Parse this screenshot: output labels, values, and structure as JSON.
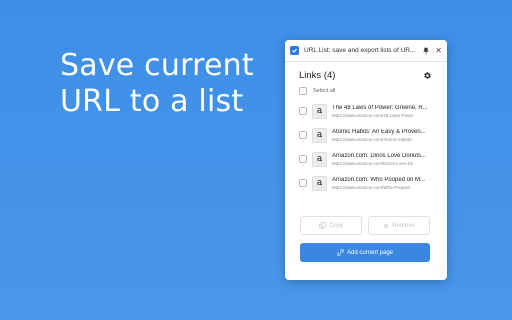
{
  "headline": {
    "line1": "Save current",
    "line2": "URL to a list"
  },
  "popup": {
    "window_title": "URL List: save and export lists of UR...",
    "close_glyph": "✕",
    "panel_title": "Links (4)",
    "select_all_label": "Select all",
    "items": [
      {
        "thumb": "a",
        "title": "The 48 Laws of Power: Greene, R...",
        "url": "https://www.amazon.com/48-Laws-Powe"
      },
      {
        "thumb": "a",
        "title": "Atomic Habits: An Easy & Proven...",
        "url": "https://www.amazon.com/Atomic-Habits-"
      },
      {
        "thumb": "a",
        "title": "Amazon.com: Dinos Love Donuts...",
        "url": "https://www.amazon.com/Dinos-Love-Do"
      },
      {
        "thumb": "a",
        "title": "Amazon.com: Who Pooped on M...",
        "url": "https://www.amazon.com/Who-Pooped-"
      }
    ],
    "copy_label": "Copy",
    "remove_label": "Remove",
    "add_label": "Add current page"
  },
  "colors": {
    "background": "#3d8fe8",
    "accent": "#3b86e0",
    "text": "#222222"
  },
  "icons": [
    "checkbox-app-icon",
    "pin-icon",
    "close-icon",
    "gear-icon",
    "copy-icon",
    "remove-icon",
    "link-icon",
    "drag-handle-icon"
  ]
}
